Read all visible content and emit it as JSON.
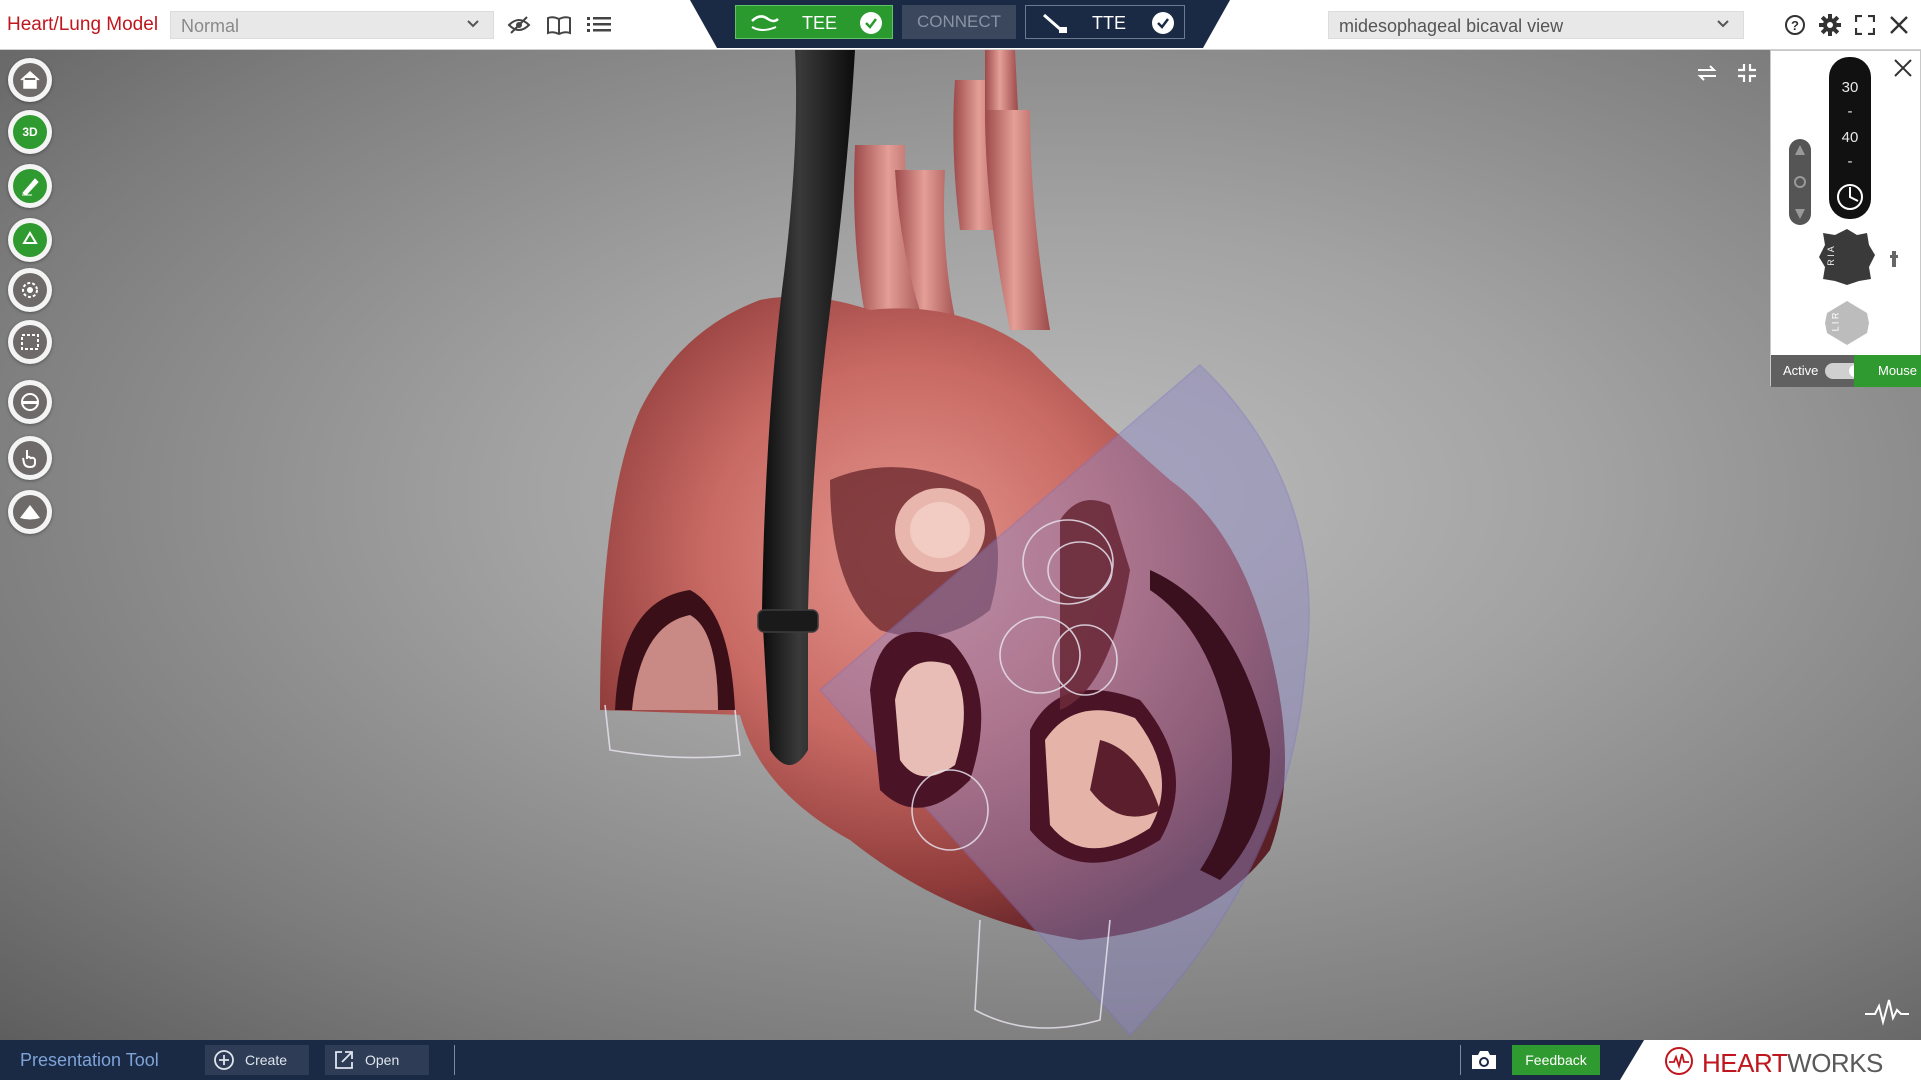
{
  "app": {
    "title": "Heart/Lung Model",
    "model_select": {
      "value": "Normal",
      "icon": "chevron-down-icon"
    },
    "view_select": {
      "value": "midesophageal bicaval view",
      "icon": "chevron-down-icon"
    }
  },
  "toolbar_icons": [
    "hide-icon",
    "library-icon",
    "list-icon"
  ],
  "top_right_icons": [
    "help-icon",
    "settings-icon",
    "fullscreen-icon",
    "close-icon"
  ],
  "center_tabs": {
    "tee": {
      "label": "TEE",
      "checked": true
    },
    "connect": {
      "label": "CONNECT"
    },
    "tte": {
      "label": "TTE",
      "checked": true
    }
  },
  "left_tools": [
    "home-icon",
    "3d-rotate-icon",
    "draw-icon",
    "recycle-icon",
    "focus-icon",
    "select-region-icon",
    "crop-icon",
    "hand-icon",
    "sector-icon"
  ],
  "left_tools_3d_label": "3D",
  "probe_panel": {
    "angle_values": [
      "30",
      "-",
      "40",
      "-"
    ],
    "rotation_knob_label": "R I A",
    "lr_knob_label": "L I R",
    "active_label": "Active",
    "mouse_label": "Mouse",
    "toggle_on": true
  },
  "bottom_bar": {
    "title": "Presentation Tool",
    "create_label": "Create",
    "open_label": "Open",
    "feedback_label": "Feedback",
    "brand_heart": "HEART",
    "brand_works": "WORKS"
  },
  "colors": {
    "brand_red": "#c0161d",
    "nav_dark": "#1b2a44",
    "accent_green": "#2f9a2f"
  }
}
